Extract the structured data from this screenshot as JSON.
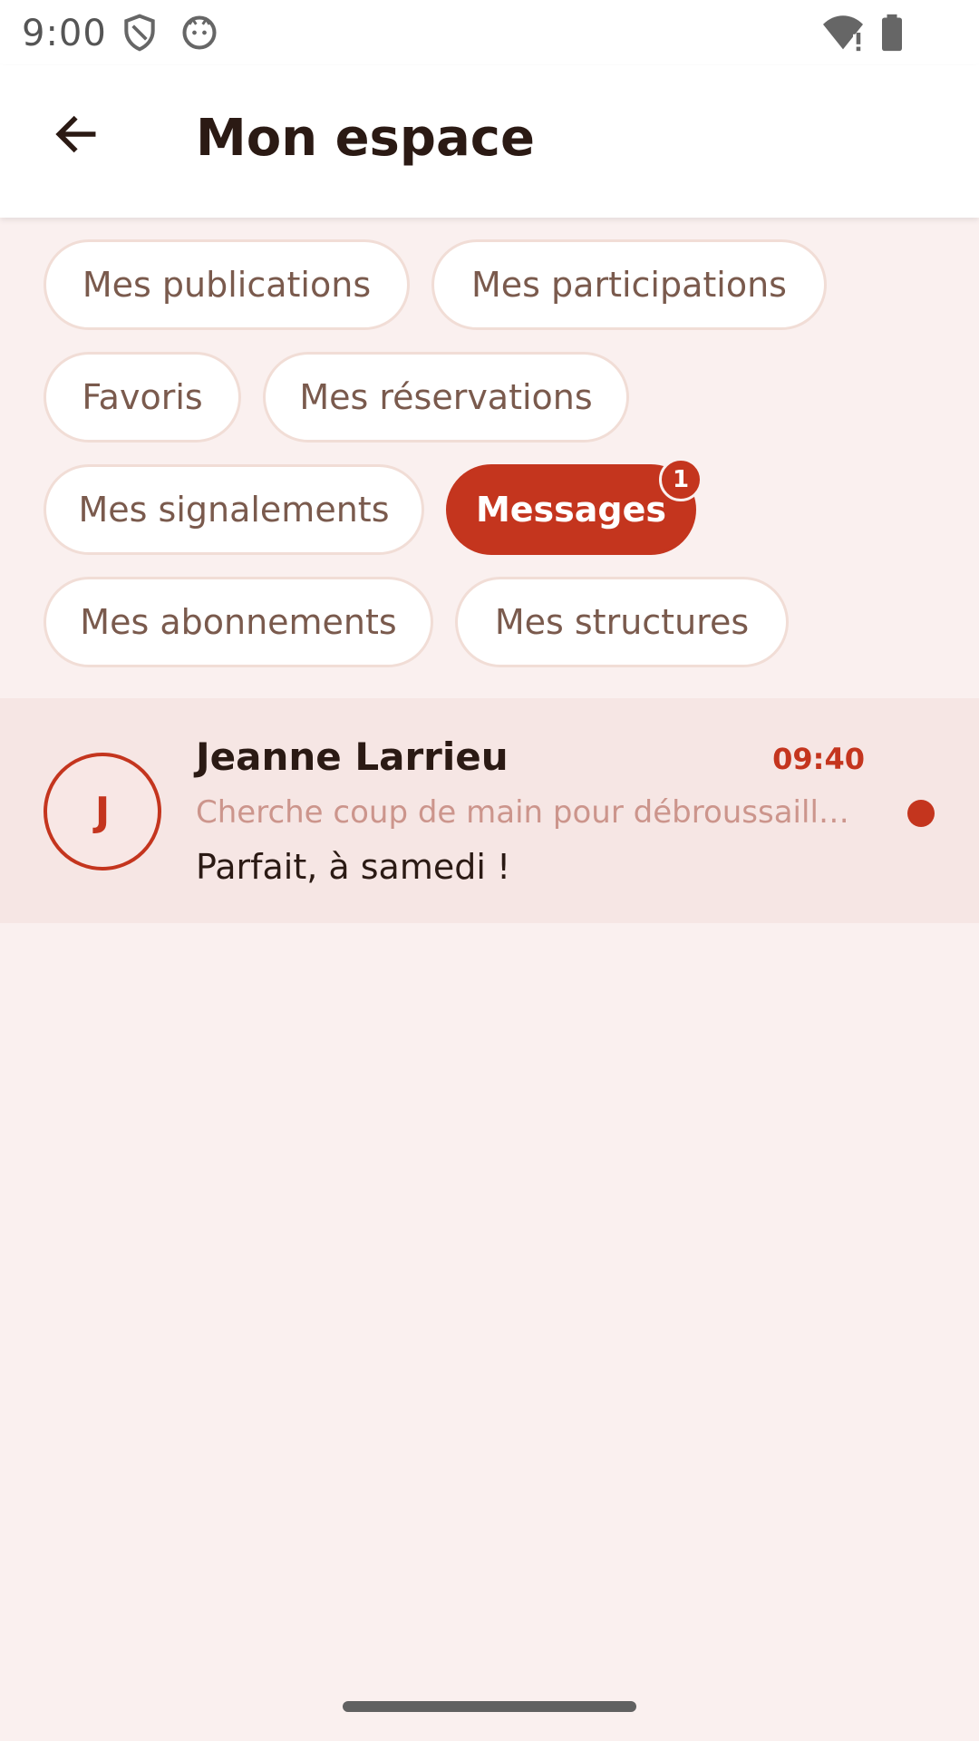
{
  "status_bar": {
    "time": "9:00",
    "icons": [
      "shield-icon",
      "cat-face-icon",
      "wifi-alert-icon",
      "battery-icon"
    ]
  },
  "app_bar": {
    "title": "Mon espace",
    "back_icon": "arrow-left-icon"
  },
  "chips": [
    {
      "label": "Mes publications",
      "active": false
    },
    {
      "label": "Mes participations",
      "active": false
    },
    {
      "label": "Favoris",
      "active": false
    },
    {
      "label": "Mes réservations",
      "active": false
    },
    {
      "label": "Mes signalements",
      "active": false
    },
    {
      "label": "Messages",
      "active": true,
      "badge": "1"
    },
    {
      "label": "Mes abonnements",
      "active": false
    },
    {
      "label": "Mes structures",
      "active": false
    }
  ],
  "conversations": [
    {
      "avatar_initial": "J",
      "name": "Jeanne Larrieu",
      "time": "09:40",
      "subject": "Cherche coup de main pour débroussailla...",
      "last_message": "Parfait, à samedi !",
      "unread": true
    }
  ],
  "colors": {
    "accent": "#c4351e",
    "background": "#faf0ef",
    "chip_text": "#7a5a4d",
    "subject_text": "#cc958c"
  }
}
